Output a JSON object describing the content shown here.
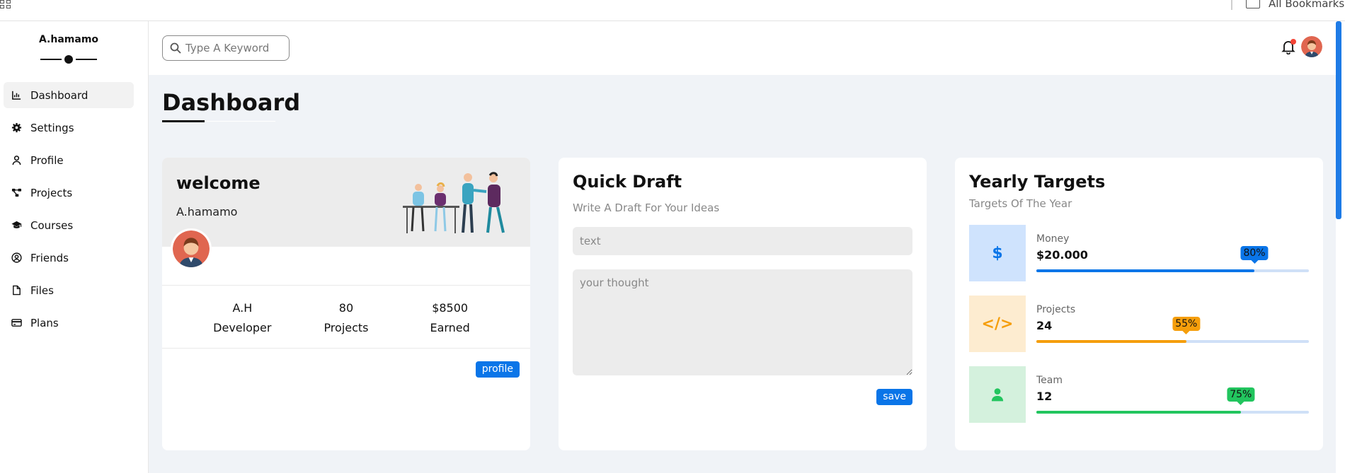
{
  "browser": {
    "bookmarks_label": "All Bookmarks"
  },
  "sidebar": {
    "brand": "A.hamamo",
    "items": [
      {
        "label": "Dashboard",
        "icon": "chart-icon",
        "active": true
      },
      {
        "label": "Settings",
        "icon": "gear-icon"
      },
      {
        "label": "Profile",
        "icon": "user-icon"
      },
      {
        "label": "Projects",
        "icon": "diagram-icon"
      },
      {
        "label": "Courses",
        "icon": "graduation-cap-icon"
      },
      {
        "label": "Friends",
        "icon": "user-circle-icon"
      },
      {
        "label": "Files",
        "icon": "file-icon"
      },
      {
        "label": "Plans",
        "icon": "credit-card-icon"
      }
    ]
  },
  "header": {
    "search_placeholder": "Type A Keyword",
    "notification_dot_color": "#f44336"
  },
  "page": {
    "title": "Dashboard"
  },
  "welcome": {
    "heading": "welcome",
    "name": "A.hamamo",
    "stats": [
      {
        "top": "A.H",
        "bottom": "Developer"
      },
      {
        "top": "80",
        "bottom": "Projects"
      },
      {
        "top": "$8500",
        "bottom": "Earned"
      }
    ],
    "button": "profile"
  },
  "draft": {
    "title": "Quick Draft",
    "subtitle": "Write A Draft For Your Ideas",
    "input_placeholder": "text",
    "textarea_placeholder": "your thought",
    "button": "save"
  },
  "targets": {
    "title": "Yearly Targets",
    "subtitle": "Targets Of The Year",
    "items": [
      {
        "label": "Money",
        "value": "$20.000",
        "percent": 80,
        "percent_label": "80%",
        "icon": "dollar-icon",
        "icon_text": "$",
        "color": "#0a75e8",
        "bg": "#cfe3fd"
      },
      {
        "label": "Projects",
        "value": "24",
        "percent": 55,
        "percent_label": "55%",
        "icon": "code-icon",
        "icon_text": "</>",
        "color": "#f59e0b",
        "bg": "#fdecd0"
      },
      {
        "label": "Team",
        "value": "12",
        "percent": 75,
        "percent_label": "75%",
        "icon": "user-icon",
        "icon_text": "",
        "color": "#22c55e",
        "bg": "#d4f1dd"
      }
    ]
  }
}
